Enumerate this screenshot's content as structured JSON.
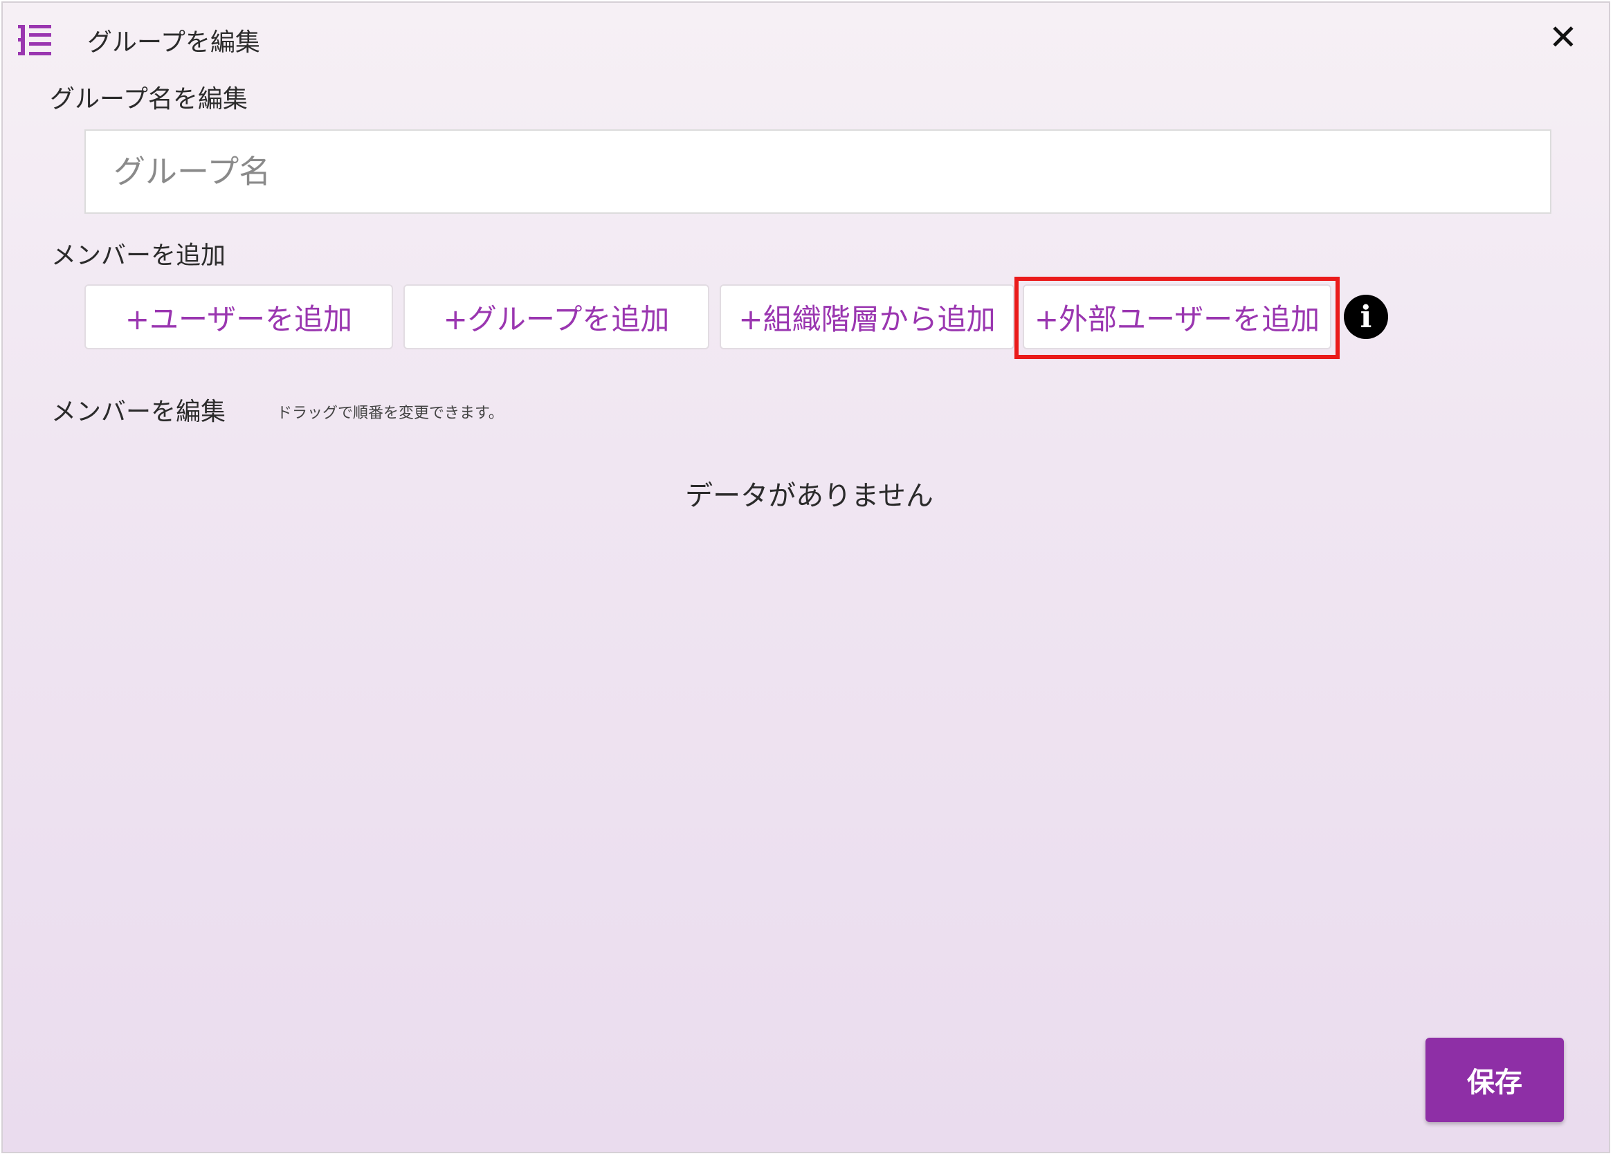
{
  "dialog": {
    "title": "グループを編集",
    "title_icon": "list-tree-icon",
    "close_symbol": "✕",
    "accent_color": "#9a36b0",
    "highlight_color": "#ea1b1b"
  },
  "group_name": {
    "label": "グループ名を編集",
    "placeholder": "グループ名",
    "value": ""
  },
  "add_members": {
    "label": "メンバーを追加",
    "buttons": [
      "+ユーザーを追加",
      "+グループを追加",
      "+組織階層から追加",
      "+外部ユーザーを追加"
    ],
    "info_symbol": "i"
  },
  "edit_members": {
    "label": "メンバーを編集",
    "hint": "ドラッグで順番を変更できます。",
    "empty_message": "データがありません"
  },
  "footer": {
    "save_label": "保存"
  }
}
